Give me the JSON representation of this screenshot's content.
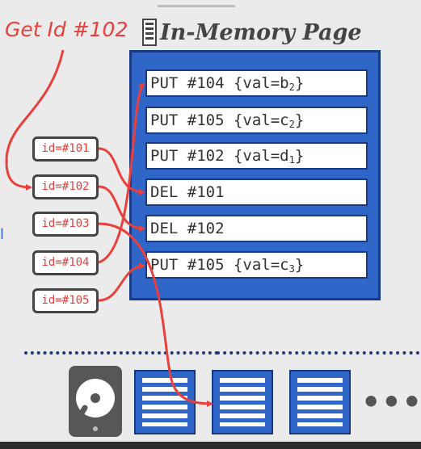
{
  "request_label": "Get Id #102",
  "page_title": "In-Memory Page",
  "records": [
    {
      "text": "PUT #104 {val=b",
      "sub": "2",
      "suffix": "}"
    },
    {
      "text": "PUT #105 {val=c",
      "sub": "2",
      "suffix": "}"
    },
    {
      "text": "PUT #102 {val=d",
      "sub": "1",
      "suffix": "}"
    },
    {
      "text": "DEL #101",
      "sub": "",
      "suffix": ""
    },
    {
      "text": "DEL #102",
      "sub": "",
      "suffix": ""
    },
    {
      "text": "PUT #105 {val=c",
      "sub": "3",
      "suffix": "}"
    }
  ],
  "ids": [
    "id=#101",
    "id=#102",
    "id=#103",
    "id=#104",
    "id=#105"
  ],
  "ellipsis": "•••",
  "colors": {
    "accent_red": "#e8403c",
    "page_blue": "#2f66c8",
    "page_border": "#163a85",
    "text_dark": "#333333"
  },
  "icons": [
    "database-page-icon",
    "hard-disk-icon",
    "disk-block-icon"
  ]
}
